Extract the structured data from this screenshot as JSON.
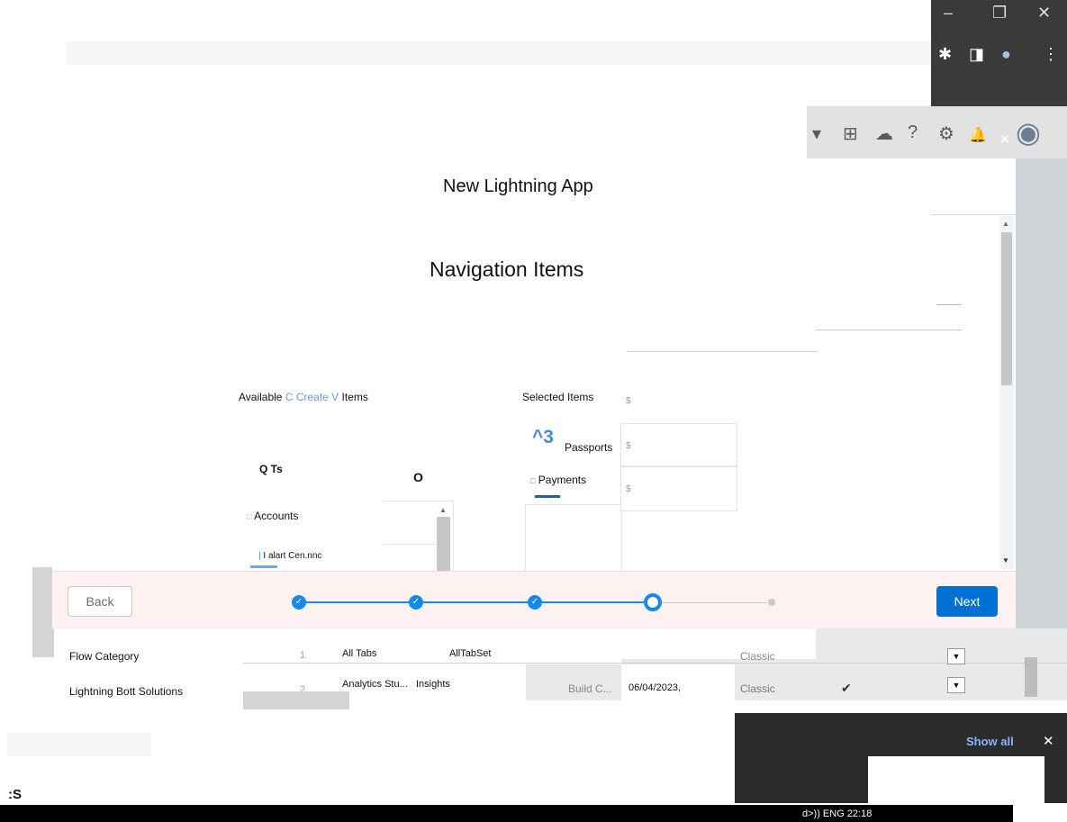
{
  "browser": {
    "window_controls": [
      "–",
      "❐",
      "✕"
    ],
    "toolbar_icons": [
      "extension-icon",
      "tab-icon",
      "profile-icon",
      "more-icon"
    ],
    "toolbar_glyphs": [
      "✱",
      "◨",
      "●",
      "⋮"
    ]
  },
  "sf_header": {
    "icons": [
      "dropdown-icon",
      "add-icon",
      "trailhead-icon",
      "help-icon",
      "setup-icon",
      "bell-icon",
      "avatar"
    ],
    "glyphs": [
      "▾",
      "⊞",
      "☁",
      "?",
      "⚙",
      "🔔",
      "◉"
    ],
    "close": "×"
  },
  "modal": {
    "title": "New Lightning App",
    "section_title": "Navigation Items",
    "available": {
      "label_prefix": "Available ",
      "label_mid": "C Create V",
      "label_suffix": " Items",
      "search": "Q Ts",
      "search_icon": "O",
      "items": [
        "Accounts",
        "I alart Cen.nnc"
      ]
    },
    "selected": {
      "label": "Selected Items",
      "count": "^3",
      "items": [
        "Passports",
        "Payments"
      ]
    },
    "side_marks": [
      "$",
      "$",
      "$"
    ]
  },
  "footer": {
    "back_label": "Back",
    "next_label": "Next",
    "step_glyph": "✓"
  },
  "background": {
    "sidebar_items": [
      "Flow Category",
      "Lightning Bott Solutions"
    ],
    "rows": [
      {
        "num": "1",
        "name": "All Tabs",
        "dev": "AllTabSet",
        "date": "",
        "ui": "Classic"
      },
      {
        "num": "2",
        "name": "Analytics Stu...",
        "dev": "Insights",
        "desc": "Build C...",
        "date": "06/04/2023,",
        "ui": "Classic"
      }
    ],
    "checkmark": "✔"
  },
  "notification": {
    "show_all": "Show all",
    "close": "✕"
  },
  "taskbar": {
    "left": ":S",
    "right": "d>)) ENG 22:18"
  }
}
